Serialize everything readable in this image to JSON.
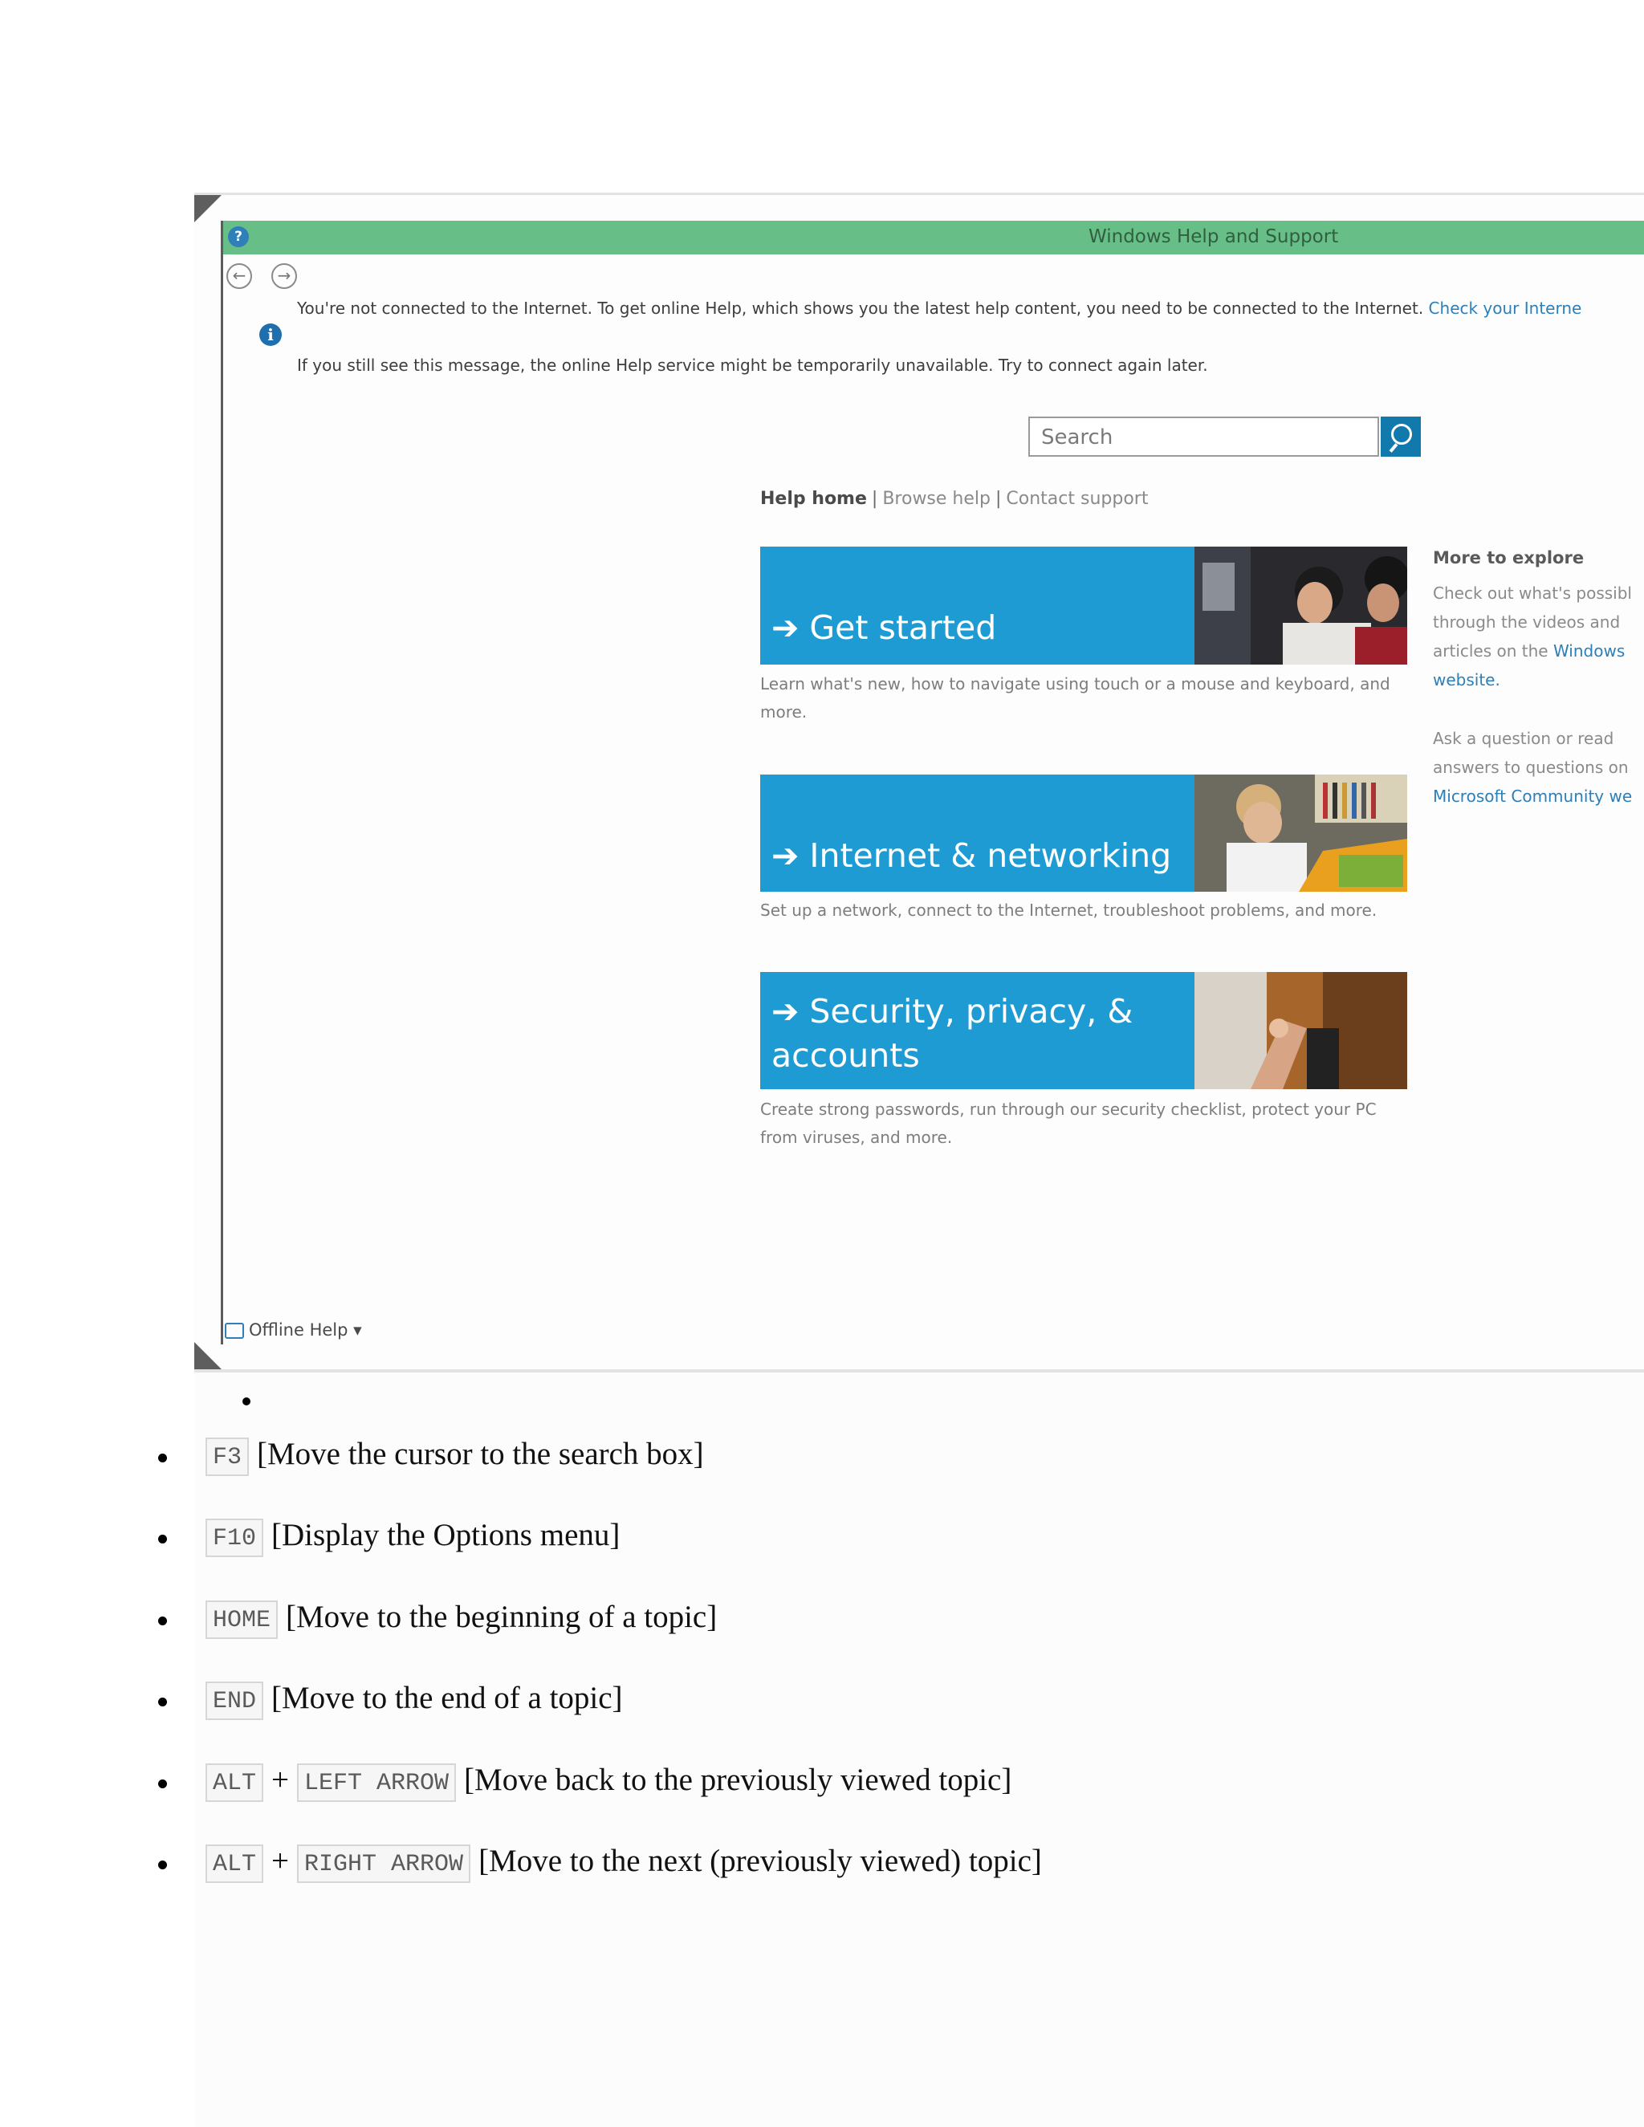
{
  "screenshot": {
    "window_title": "Windows Help and Support",
    "offline_message_line1": "You're not connected to the Internet. To get online Help, which shows you the latest help content, you need to be connected to the Internet.",
    "offline_message_link": "Check your Interne",
    "offline_message_line2": "If you still see this message, the online Help service might be temporarily unavailable. Try to connect again later.",
    "search_placeholder": "Search",
    "help_nav": {
      "home": "Help home",
      "browse": "Browse help",
      "contact": "Contact support",
      "separator": "|"
    },
    "tiles": [
      {
        "label": "➔ Get started",
        "description": "Learn what's new, how to navigate using touch or a mouse and keyboard, and more."
      },
      {
        "label": "➔ Internet & networking",
        "description": "Set up a network, connect to the Internet, troubleshoot problems, and more."
      },
      {
        "label_line1": "➔ Security, privacy, &",
        "label_line2": "accounts",
        "description": "Create strong passwords, run through our security checklist, protect your PC from viruses, and more."
      }
    ],
    "more_to_explore": {
      "title": "More to explore",
      "p1_text": "Check out what's possibl through the videos and articles on the",
      "p1_link": "Windows website.",
      "p2_text": "Ask a question or read answers to questions on",
      "p2_link": "Microsoft Community we"
    },
    "footer": "Offline Help ▾",
    "colors": {
      "title_bar": "#67bf87",
      "tile": "#1f9bd3",
      "search_button": "#1279ad",
      "link": "#2c7fb8"
    }
  },
  "shortcuts": [
    {
      "keys": [
        "F3"
      ],
      "description": "[Move  the cursor to the search box]"
    },
    {
      "keys": [
        "F10"
      ],
      "description": "[Display  the Options menu]"
    },
    {
      "keys": [
        "HOME"
      ],
      "description": "[Move  to the beginning  of a topic]"
    },
    {
      "keys": [
        "END"
      ],
      "description": "[Move  to the end of a topic]"
    },
    {
      "keys": [
        "ALT",
        "LEFT ARROW"
      ],
      "description": "[Move back to the previously viewed  topic]"
    },
    {
      "keys": [
        "ALT",
        "RIGHT ARROW"
      ],
      "description": "[Move  to the next (previously viewed)  topic]"
    }
  ],
  "key_joiner": "+"
}
